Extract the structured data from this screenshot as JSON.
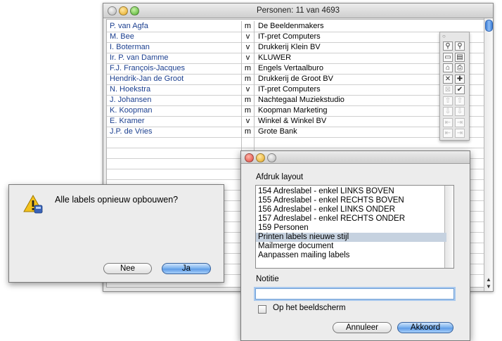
{
  "window": {
    "title": "Personen: 11 van 4693"
  },
  "table": {
    "rows": [
      {
        "name": "P. van Agfa",
        "gender": "m",
        "org": "De Beeldenmakers"
      },
      {
        "name": "M. Bee",
        "gender": "v",
        "org": "IT-pret Computers"
      },
      {
        "name": "I. Boterman",
        "gender": "v",
        "org": "Drukkerij Klein BV"
      },
      {
        "name": "Ir. P. van Damme",
        "gender": "v",
        "org": "KLUWER"
      },
      {
        "name": "F.J. François-Jacques",
        "gender": "m",
        "org": "Engels Vertaalburo"
      },
      {
        "name": "Hendrik-Jan de Groot",
        "gender": "m",
        "org": "Drukkerij de Groot BV"
      },
      {
        "name": "N. Hoekstra",
        "gender": "v",
        "org": "IT-pret Computers"
      },
      {
        "name": "J. Johansen",
        "gender": "m",
        "org": "Nachtegaal Muziekstudio"
      },
      {
        "name": "K. Koopman",
        "gender": "m",
        "org": "Koopman Marketing"
      },
      {
        "name": "E. Kramer",
        "gender": "v",
        "org": "Winkel & Winkel BV"
      },
      {
        "name": "J.P. de Vries",
        "gender": "m",
        "org": "Grote Bank"
      }
    ]
  },
  "palette": {
    "buttons": [
      {
        "icon": "zoom-in-icon",
        "glyph": "⚲"
      },
      {
        "icon": "zoom-out-icon",
        "glyph": "⚲"
      },
      {
        "icon": "form-view-icon",
        "glyph": "▭"
      },
      {
        "icon": "list-view-icon",
        "glyph": "▤"
      },
      {
        "icon": "home-icon",
        "glyph": "⌂"
      },
      {
        "icon": "print-icon",
        "glyph": "⎙"
      },
      {
        "icon": "delete-icon",
        "glyph": "✕"
      },
      {
        "icon": "add-icon",
        "glyph": "✚"
      },
      {
        "icon": "omit-icon",
        "glyph": "⊠"
      },
      {
        "icon": "checkmark-icon",
        "glyph": "✔"
      },
      {
        "icon": "first-record-icon",
        "glyph": "⇧"
      },
      {
        "icon": "previous-record-icon",
        "glyph": "⇧"
      },
      {
        "icon": "next-record-icon",
        "glyph": "⇩"
      },
      {
        "icon": "last-record-icon",
        "glyph": "⇩"
      },
      {
        "icon": "import-icon",
        "glyph": "⇤"
      },
      {
        "icon": "export-icon",
        "glyph": "⇥"
      },
      {
        "icon": "import-alt-icon",
        "glyph": "⇤"
      },
      {
        "icon": "export-alt-icon",
        "glyph": "⇥"
      }
    ]
  },
  "confirm": {
    "message": "Alle labels opnieuw opbouwen?",
    "no_label": "Nee",
    "yes_label": "Ja"
  },
  "print_dialog": {
    "layout_label": "Afdruk layout",
    "layouts": [
      "154  Adreslabel - enkel  LINKS BOVEN",
      "155  Adreslabel - enkel  RECHTS BOVEN",
      "156  Adreslabel - enkel  LINKS ONDER",
      "157  Adreslabel - enkel  RECHTS ONDER",
      "159  Personen",
      "Printen labels nieuwe stijl",
      "Mailmerge document",
      "Aanpassen mailing labels"
    ],
    "selected_index": 5,
    "notitie_label": "Notitie",
    "notitie_value": "",
    "screen_checkbox_label": "Op het beeldscherm",
    "screen_checkbox_checked": false,
    "cancel_label": "Annuleer",
    "ok_label": "Akkoord"
  }
}
